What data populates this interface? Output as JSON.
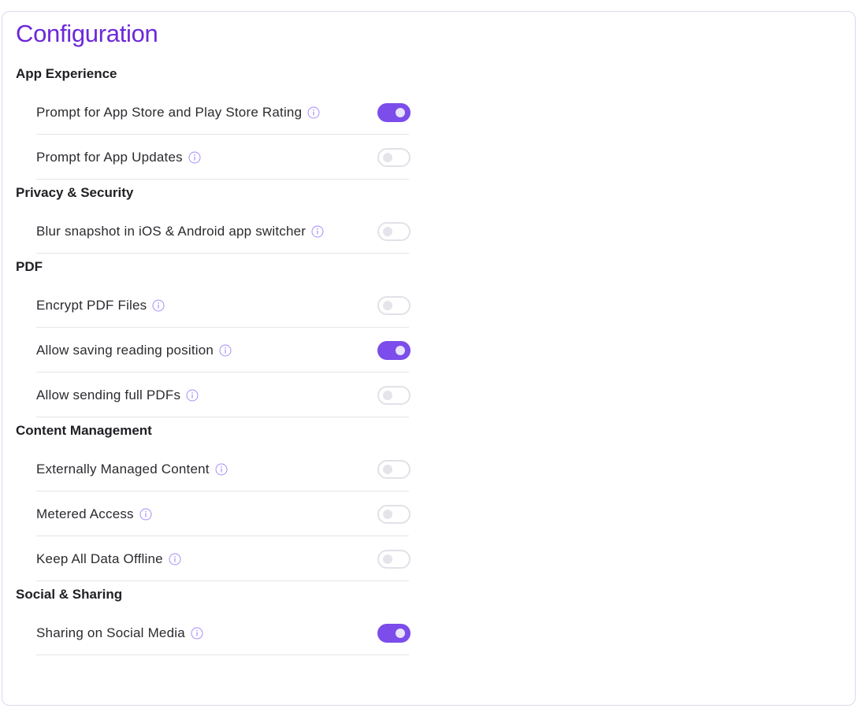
{
  "title": "Configuration",
  "accent_color": "#7c4dea",
  "sections": [
    {
      "heading": "App Experience",
      "items": [
        {
          "label": "Prompt for App Store and Play Store Rating",
          "enabled": true,
          "icon": "info-icon"
        },
        {
          "label": "Prompt for App Updates",
          "enabled": false,
          "icon": "info-icon"
        }
      ]
    },
    {
      "heading": "Privacy & Security",
      "items": [
        {
          "label": "Blur snapshot in iOS & Android app switcher",
          "enabled": false,
          "icon": "info-icon"
        }
      ]
    },
    {
      "heading": "PDF",
      "items": [
        {
          "label": "Encrypt PDF Files",
          "enabled": false,
          "icon": "info-icon"
        },
        {
          "label": "Allow saving reading position",
          "enabled": true,
          "icon": "info-icon"
        },
        {
          "label": "Allow sending full PDFs",
          "enabled": false,
          "icon": "info-icon"
        }
      ]
    },
    {
      "heading": "Content Management",
      "items": [
        {
          "label": "Externally Managed Content",
          "enabled": false,
          "icon": "info-icon"
        },
        {
          "label": "Metered Access",
          "enabled": false,
          "icon": "info-icon"
        },
        {
          "label": "Keep All Data Offline",
          "enabled": false,
          "icon": "info-icon"
        }
      ]
    },
    {
      "heading": "Social & Sharing",
      "items": [
        {
          "label": "Sharing on Social Media",
          "enabled": true,
          "icon": "info-icon"
        }
      ]
    }
  ]
}
